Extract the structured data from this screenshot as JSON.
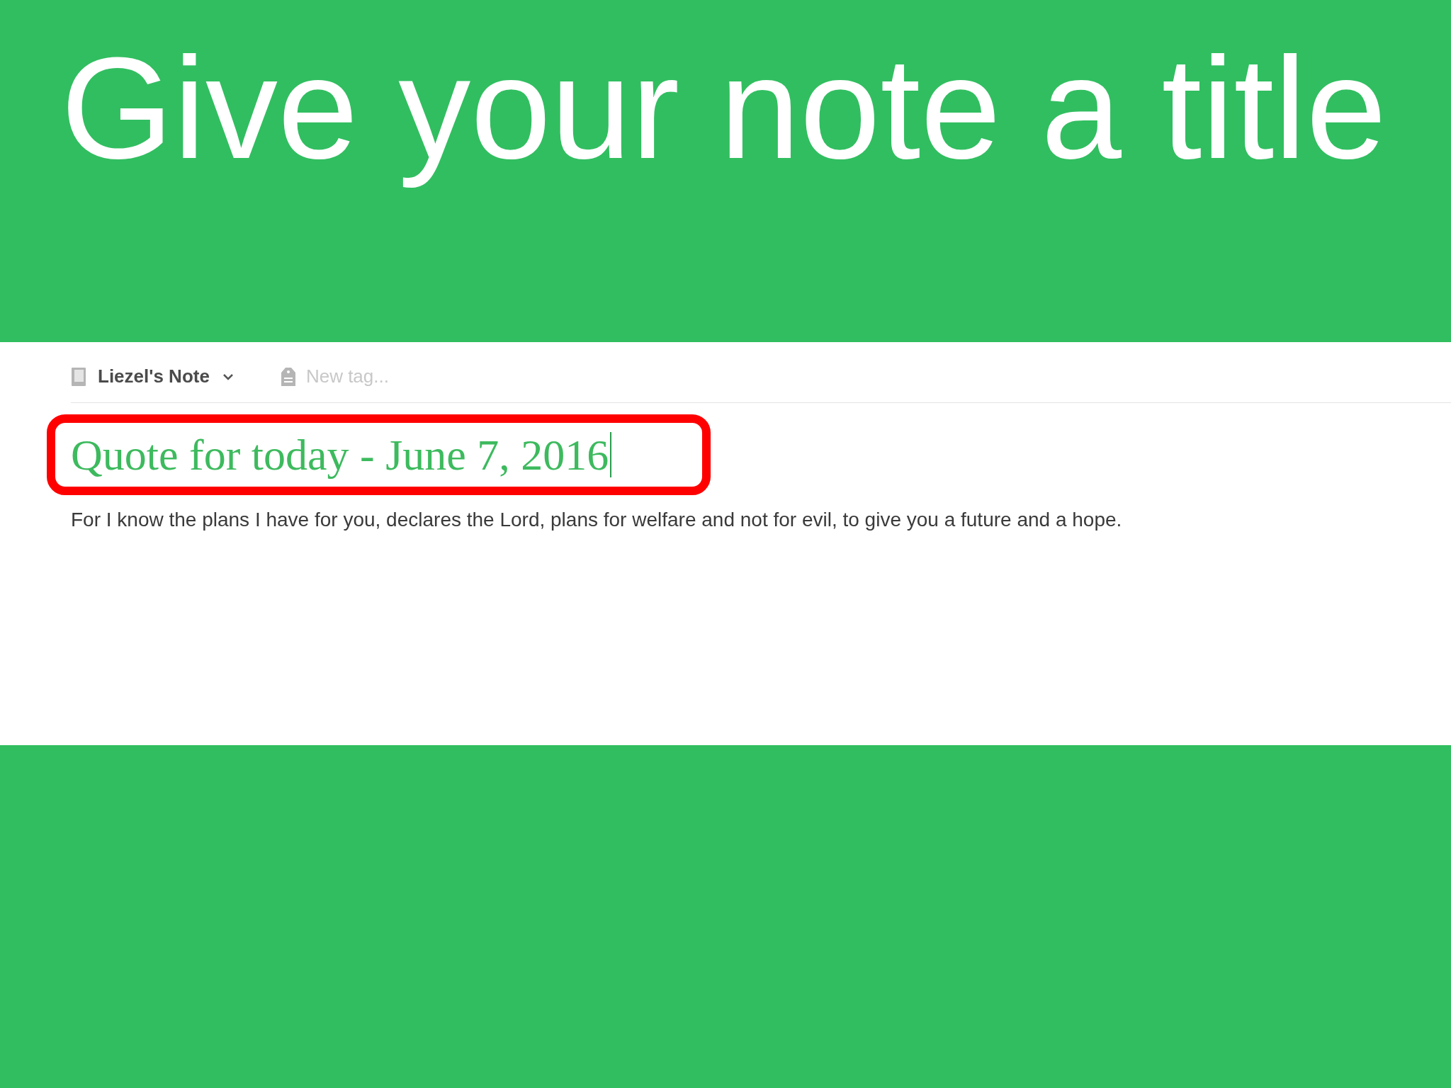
{
  "slide_title": "Give your note a title",
  "note": {
    "notebook": "Liezel's Note",
    "tag_field": {
      "placeholder": "New tag..."
    },
    "title": "Quote for today - June 7, 2016",
    "body": "For I know the plans I have for you, declares the Lord, plans for welfare and not for evil, to give you a future and a hope."
  }
}
